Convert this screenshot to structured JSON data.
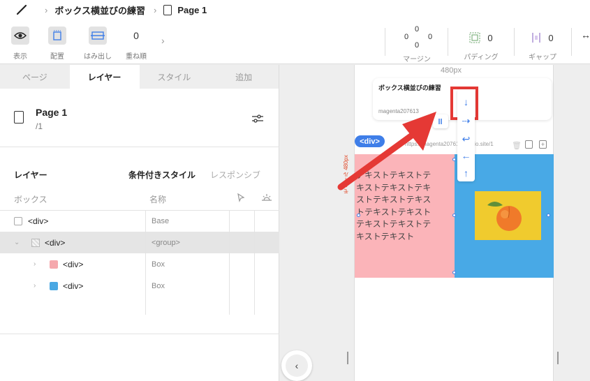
{
  "breadcrumb": {
    "project": "ボックス横並びの練習",
    "page": "Page 1"
  },
  "toolbar": {
    "display_label": "表示",
    "placement_label": "配置",
    "overflow_label": "はみ出し",
    "zindex_value": "0",
    "zindex_label": "重ね順",
    "margin": {
      "top": "0",
      "left": "0",
      "right": "0",
      "bottom": "0",
      "label": "マージン"
    },
    "padding": {
      "value": "0",
      "label": "パディング"
    },
    "gap": {
      "value": "0",
      "label": "ギャップ"
    }
  },
  "tabs": [
    "ページ",
    "レイヤー",
    "スタイル",
    "追加"
  ],
  "page": {
    "title": "Page 1",
    "path": "/1"
  },
  "layers": {
    "title": "レイヤー",
    "conditional_style": "条件付きスタイル",
    "responsive": "レスポンシブ",
    "col_box": "ボックス",
    "col_name": "名称",
    "rows": [
      {
        "name": "<div>",
        "alias": "Base"
      },
      {
        "name": "<div>",
        "alias": "<group>"
      },
      {
        "name": "<div>",
        "alias": "Box",
        "color": "#f5a8ad"
      },
      {
        "name": "<div>",
        "alias": "Box",
        "color": "#4aa8e3"
      }
    ]
  },
  "canvas": {
    "width_label": "480px",
    "card_title": "ボックス横並びの練習",
    "card_url": "magenta207613",
    "div_tag": "<div>",
    "url": "https://magenta207613.studio.site/1",
    "vertical_label": "モバイル 480px",
    "pink_text": "テキストテキストテキストテキストテキストテキストテキストテキストテキストテキストテキストテキストテキスト"
  },
  "colors": {
    "accent": "#3f7ee8",
    "pink": "#fbb4b9",
    "blue": "#48a9e6",
    "yellow": "#f0cb2e",
    "red": "#e53935"
  }
}
